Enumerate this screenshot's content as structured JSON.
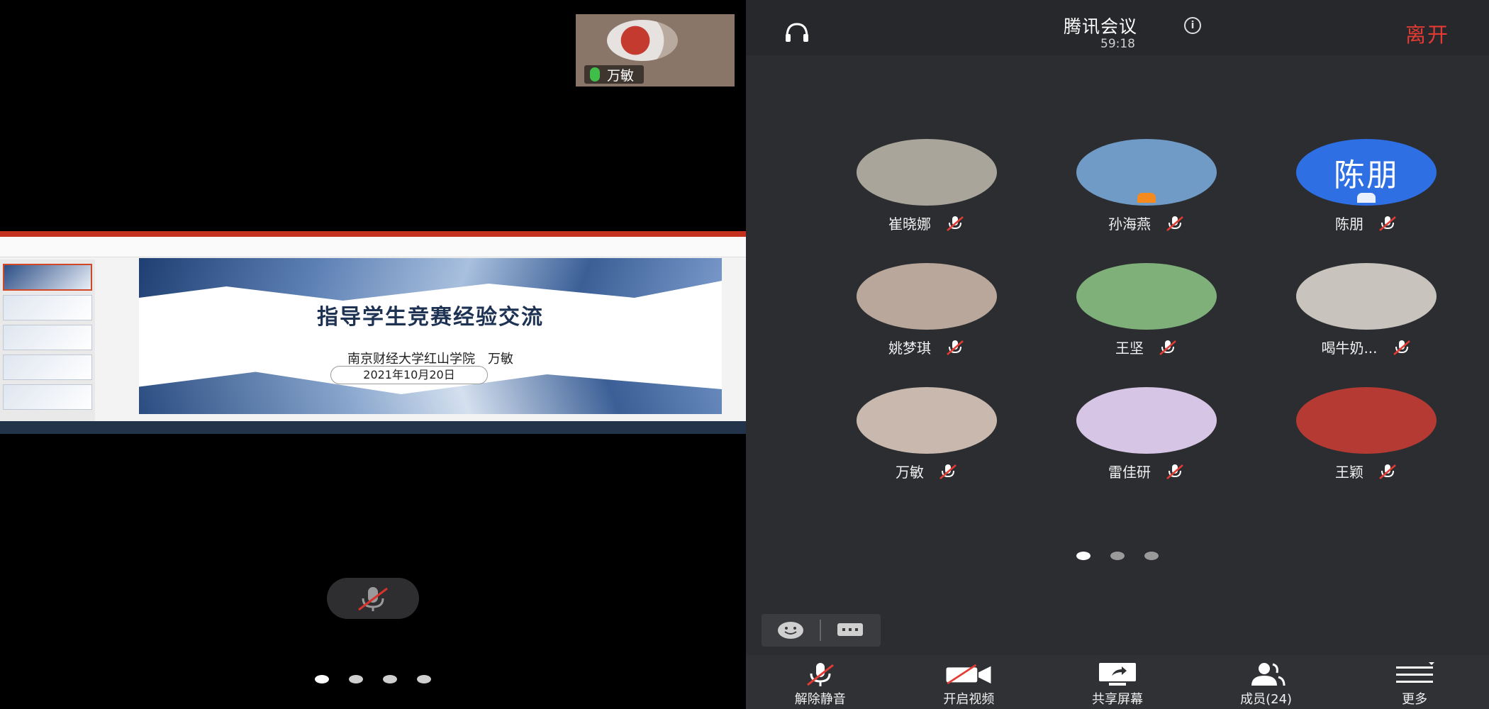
{
  "pip": {
    "name": "万敏"
  },
  "slide": {
    "title": "指导学生竞赛经验交流",
    "subtitle": "南京财经大学红山学院　万敏",
    "date": "2021年10月20日"
  },
  "left_pager": {
    "count": 4,
    "active": 0
  },
  "header": {
    "title": "腾讯会议",
    "timer": "59:18",
    "leave_label": "离开"
  },
  "participants": [
    {
      "name": "崔晓娜",
      "avatar_text": "",
      "color": "#a9a59a"
    },
    {
      "name": "孙海燕",
      "avatar_text": "",
      "color": "#6f9bc6"
    },
    {
      "name": "陈朋",
      "avatar_text": "陈朋",
      "color": "#2f6fe4"
    },
    {
      "name": "姚梦琪",
      "avatar_text": "",
      "color": "#b8a79a"
    },
    {
      "name": "王坚",
      "avatar_text": "",
      "color": "#7fb07a"
    },
    {
      "name": "喝牛奶...",
      "avatar_text": "",
      "color": "#c9c3be"
    },
    {
      "name": "万敏",
      "avatar_text": "",
      "color": "#c9b8ae"
    },
    {
      "name": "雷佳研",
      "avatar_text": "",
      "color": "#d7c5e6"
    },
    {
      "name": "王颖",
      "avatar_text": "",
      "color": "#b53a34"
    }
  ],
  "right_pager": {
    "count": 3,
    "active": 0
  },
  "toolbar": {
    "unmute": "解除静音",
    "video": "开启视频",
    "share": "共享屏幕",
    "members": "成员(24)",
    "more": "更多"
  }
}
